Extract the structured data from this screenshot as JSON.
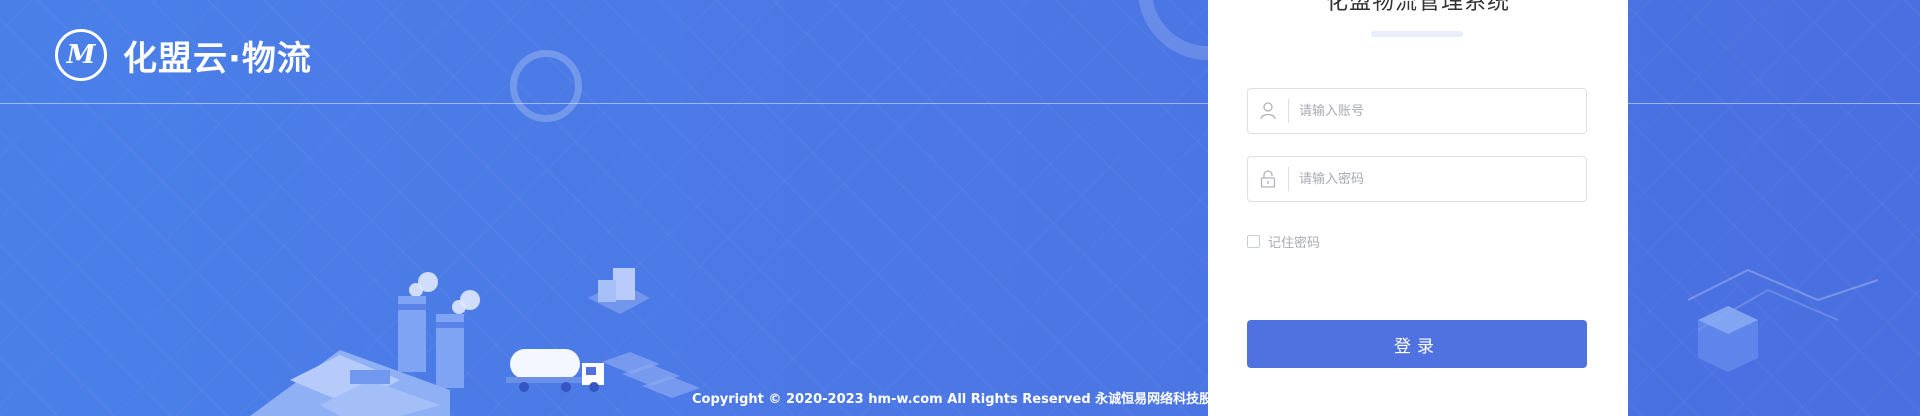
{
  "brand": {
    "logo_letter": "M",
    "name": "化盟云·物流"
  },
  "login": {
    "title": "化盟物流管理系统",
    "username_placeholder": "请输入账号",
    "password_placeholder": "请输入密码",
    "remember_label": "记住密码",
    "submit_label": "登录"
  },
  "footer": {
    "copyright": "Copyright © 2020-2023 hm-w.com All Rights Reserved 永诚恒易网络科技股份有限公司"
  },
  "icons": {
    "user": "user-icon",
    "lock": "lock-icon"
  },
  "colors": {
    "background": "#4a7fe8",
    "button": "#4f72e0",
    "card": "#ffffff"
  }
}
